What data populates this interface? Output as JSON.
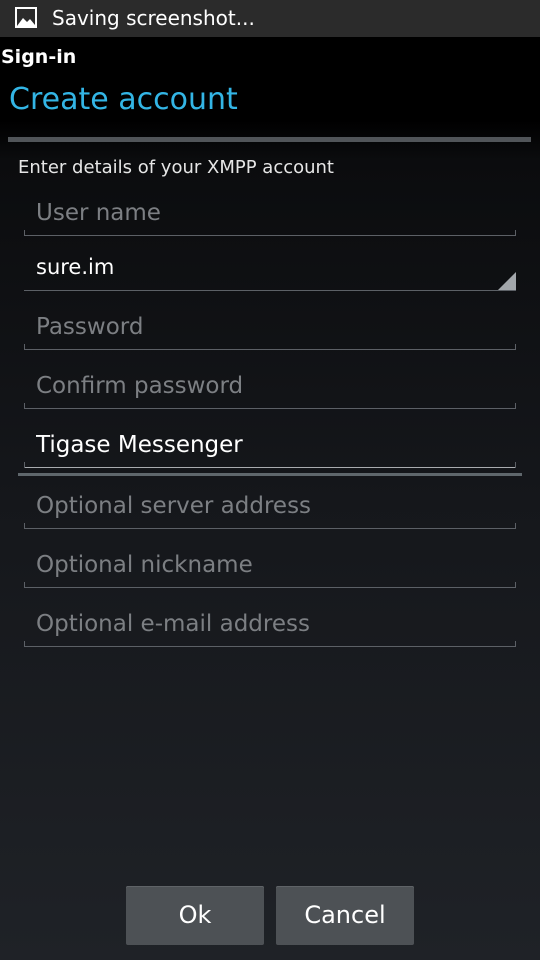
{
  "status_bar": {
    "notification_icon": "image-icon",
    "text": "Saving screenshot..."
  },
  "window": {
    "title": "Sign-in"
  },
  "dialog": {
    "title": "Create account",
    "accent_color": "#33b5e5",
    "instructions": "Enter details of your XMPP account"
  },
  "form": {
    "username": {
      "value": "",
      "placeholder": "User name"
    },
    "domain": {
      "selected": "sure.im"
    },
    "password": {
      "value": "",
      "placeholder": "Password"
    },
    "confirm_password": {
      "value": "",
      "placeholder": "Confirm password"
    },
    "account_name": {
      "value": "Tigase Messenger",
      "placeholder": ""
    },
    "server_address": {
      "value": "",
      "placeholder": "Optional server address"
    },
    "nickname": {
      "value": "",
      "placeholder": "Optional nickname"
    },
    "email": {
      "value": "",
      "placeholder": "Optional e-mail address"
    }
  },
  "buttons": {
    "ok_label": "Ok",
    "cancel_label": "Cancel"
  }
}
